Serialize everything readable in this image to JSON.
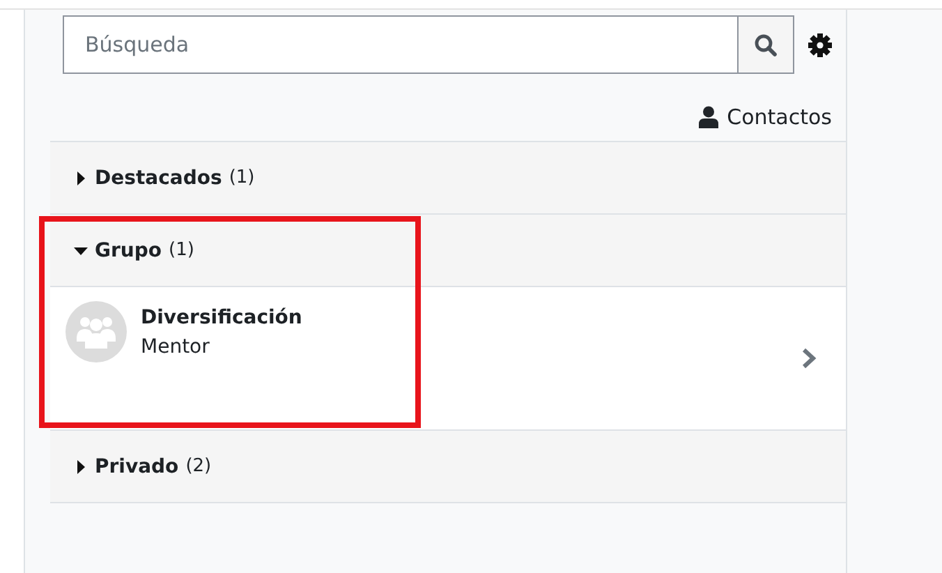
{
  "search": {
    "placeholder": "Búsqueda"
  },
  "contacts_link": "Contactos",
  "sections": [
    {
      "title": "Destacados",
      "count": "(1)",
      "expanded": false,
      "highlighted": false
    },
    {
      "title": "Grupo",
      "count": "(1)",
      "expanded": true,
      "highlighted": true,
      "items": [
        {
          "name": "Diversificación",
          "subtitle": "Mentor"
        }
      ]
    },
    {
      "title": "Privado",
      "count": "(2)",
      "expanded": false,
      "highlighted": false
    }
  ]
}
